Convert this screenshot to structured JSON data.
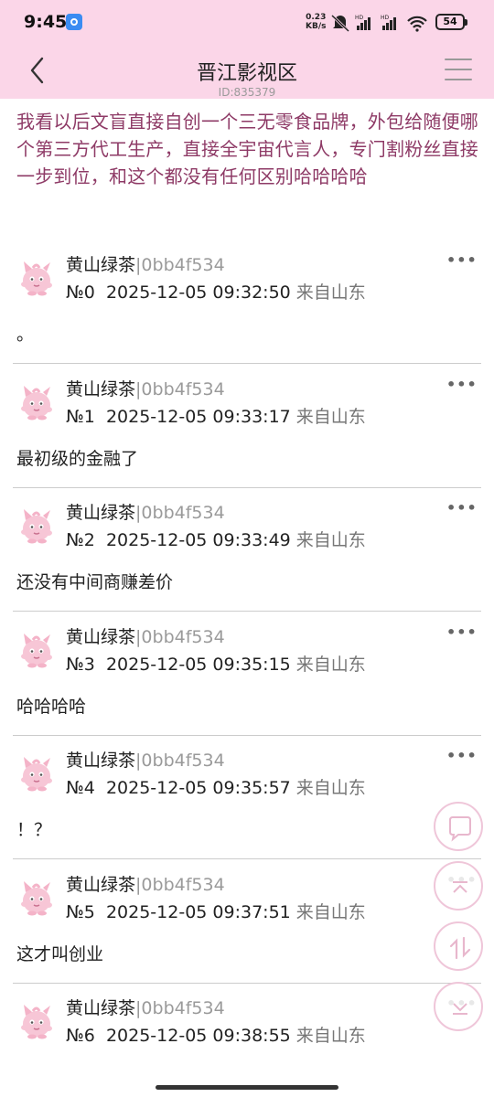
{
  "status": {
    "time": "9:45",
    "net_speed_value": "0.23",
    "net_speed_unit": "KB/s",
    "battery": "54"
  },
  "header": {
    "title": "晋江影视区",
    "post_id": "ID:835379"
  },
  "post": {
    "body": "我看以后文盲直接自创一个三无零食品牌，外包给随便哪个第三方代工生产，直接全宇宙代言人，专门割粉丝直接一步到位，和这个都没有任何区别哈哈哈哈"
  },
  "replies": [
    {
      "username": "黄山绿茶",
      "userid": "|0bb4f534",
      "floor": "№0",
      "time": "2025-12-05 09:32:50",
      "location": "来自山东",
      "content": "。"
    },
    {
      "username": "黄山绿茶",
      "userid": "|0bb4f534",
      "floor": "№1",
      "time": "2025-12-05 09:33:17",
      "location": "来自山东",
      "content": "最初级的金融了"
    },
    {
      "username": "黄山绿茶",
      "userid": "|0bb4f534",
      "floor": "№2",
      "time": "2025-12-05 09:33:49",
      "location": "来自山东",
      "content": "还没有中间商赚差价"
    },
    {
      "username": "黄山绿茶",
      "userid": "|0bb4f534",
      "floor": "№3",
      "time": "2025-12-05 09:35:15",
      "location": "来自山东",
      "content": "哈哈哈哈"
    },
    {
      "username": "黄山绿茶",
      "userid": "|0bb4f534",
      "floor": "№4",
      "time": "2025-12-05 09:35:57",
      "location": "来自山东",
      "content": "！？"
    },
    {
      "username": "黄山绿茶",
      "userid": "|0bb4f534",
      "floor": "№5",
      "time": "2025-12-05 09:37:51",
      "location": "来自山东",
      "content": "这才叫创业"
    },
    {
      "username": "黄山绿茶",
      "userid": "|0bb4f534",
      "floor": "№6",
      "time": "2025-12-05 09:38:55",
      "location": "来自山东",
      "content": ""
    }
  ],
  "more_label": "•••",
  "icons": {
    "back": "chevron-left-icon",
    "menu": "hamburger-menu-icon",
    "comment": "comment-icon",
    "to_top": "scroll-to-top-icon",
    "swap": "swap-order-icon",
    "to_bottom": "scroll-to-bottom-icon"
  },
  "colors": {
    "header_bg": "#fbd6e8",
    "post_text": "#8e3a66",
    "float_border": "#efc6d9"
  }
}
